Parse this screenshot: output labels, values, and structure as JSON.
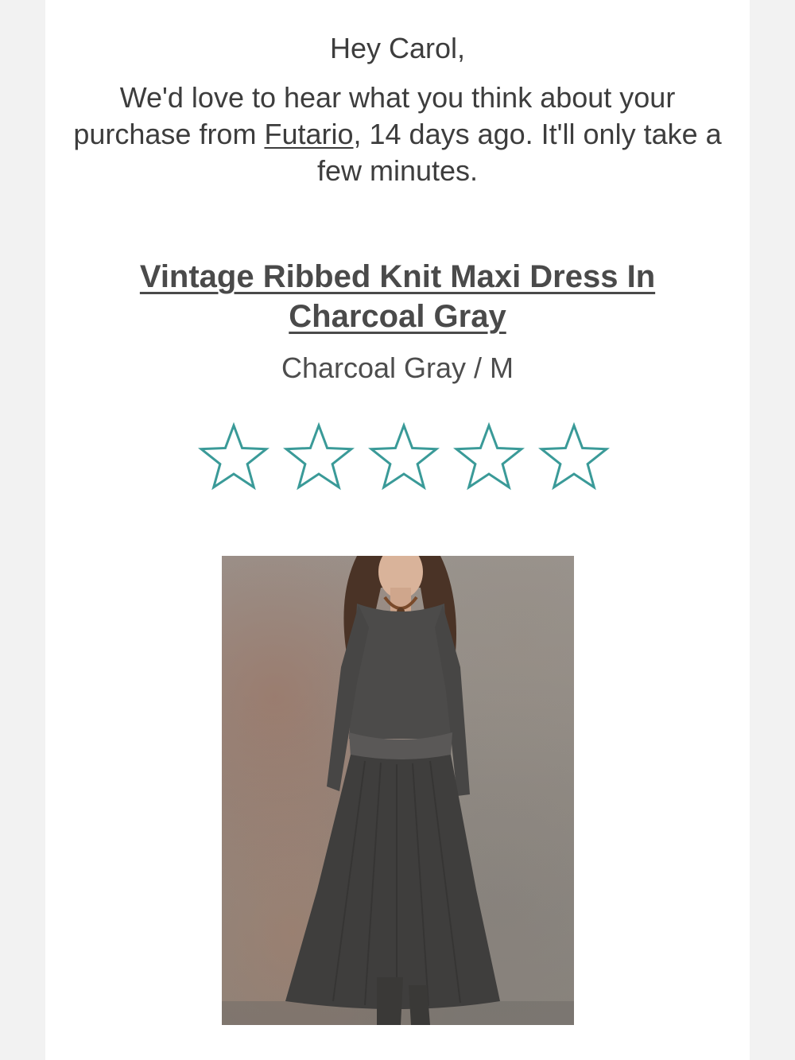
{
  "email": {
    "greeting": "Hey Carol,",
    "intro_before": "We'd love to hear what you think about your purchase from ",
    "store_link": "Futario",
    "intro_after": ", 14 days ago. It'll only take a few minutes."
  },
  "product": {
    "title": "Vintage Ribbed Knit Maxi Dress In Charcoal Gray",
    "variant": "Charcoal Gray / M",
    "image_icon": "product-photo"
  },
  "rating": {
    "star_count": 5,
    "selected": 0,
    "star_icon": "star-outline-icon",
    "accent_color": "#3a9a98"
  }
}
